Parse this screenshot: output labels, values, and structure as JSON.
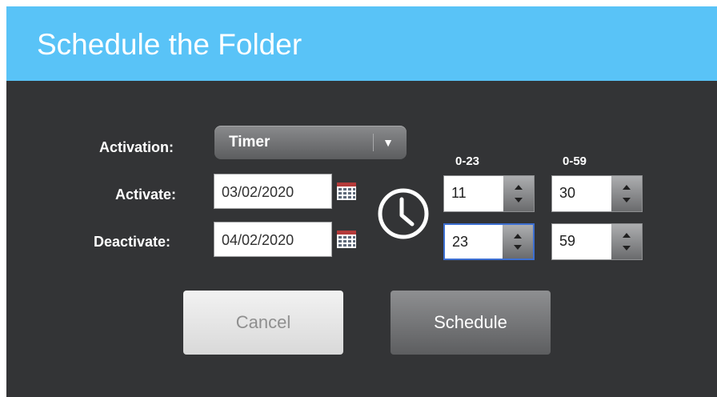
{
  "dialog": {
    "title": "Schedule the Folder"
  },
  "activation": {
    "label": "Activation:",
    "selected": "Timer"
  },
  "activate": {
    "label": "Activate:",
    "date": "03/02/2020",
    "hour": "11",
    "minute": "30"
  },
  "deactivate": {
    "label": "Deactivate:",
    "date": "04/02/2020",
    "hour": "23",
    "minute": "59"
  },
  "ranges": {
    "hour": "0-23",
    "minute": "0-59"
  },
  "buttons": {
    "cancel": "Cancel",
    "schedule": "Schedule"
  },
  "colors": {
    "titlebar": "#59c3f7",
    "panel": "#333436",
    "focus": "#3d6fd1"
  },
  "icons": {
    "calendar": "calendar-icon",
    "clock": "clock-icon",
    "dropdown": "chevron-down-icon"
  }
}
